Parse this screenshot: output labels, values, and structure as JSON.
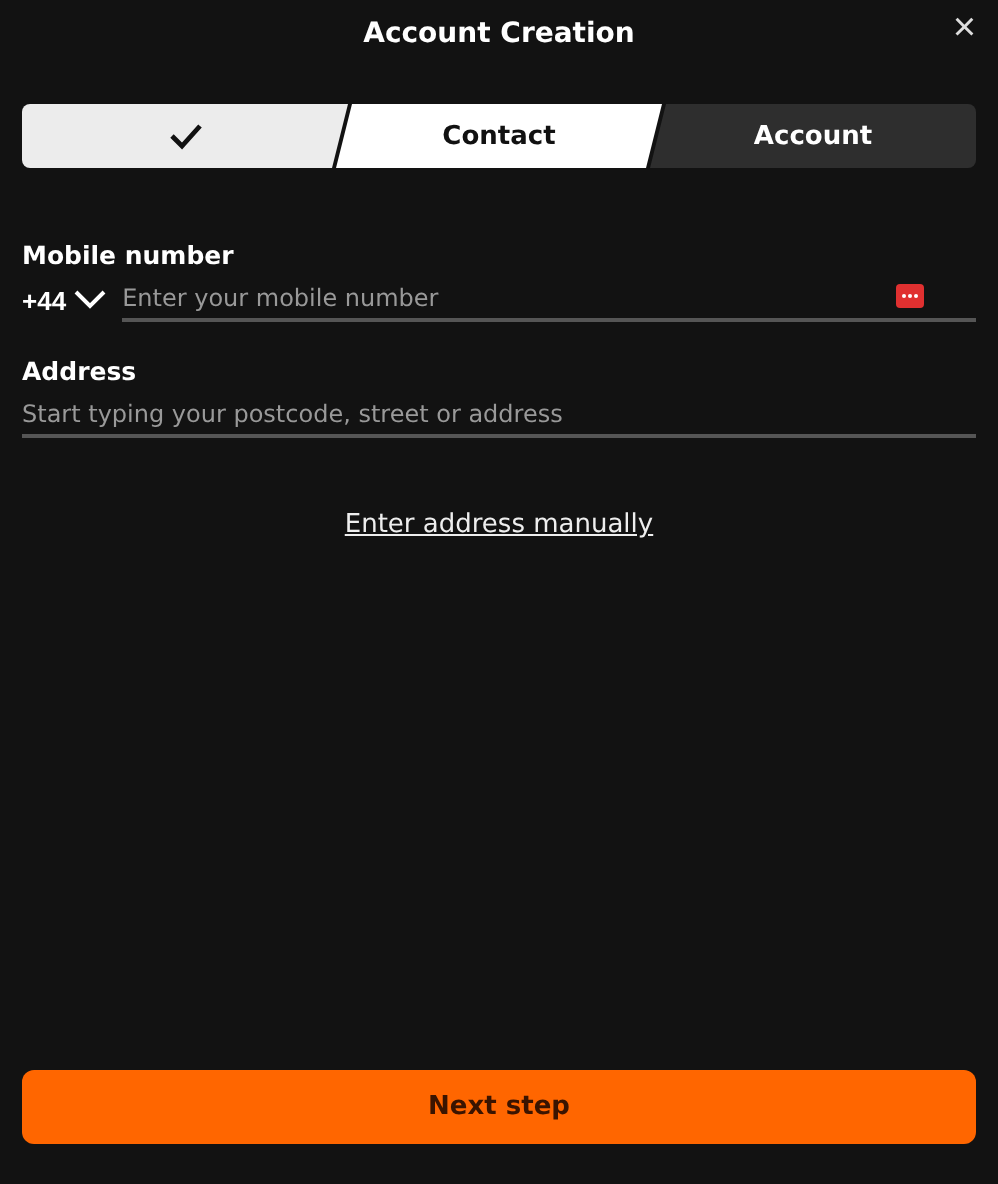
{
  "window": {
    "title": "Account Creation",
    "close": "×"
  },
  "steps": [
    {
      "completed": true,
      "selected": false
    },
    {
      "label": "Contact",
      "completed": false,
      "selected": true
    },
    {
      "label": "Account",
      "completed": false,
      "selected": false
    }
  ],
  "mobile": {
    "label": "Mobile number",
    "country_code": "+44",
    "placeholder": "Enter your mobile number"
  },
  "address": {
    "label": "Address",
    "placeholder": "Start typing your postcode, street or address"
  },
  "manual_link": "Enter address manually",
  "next_button": "Next step"
}
